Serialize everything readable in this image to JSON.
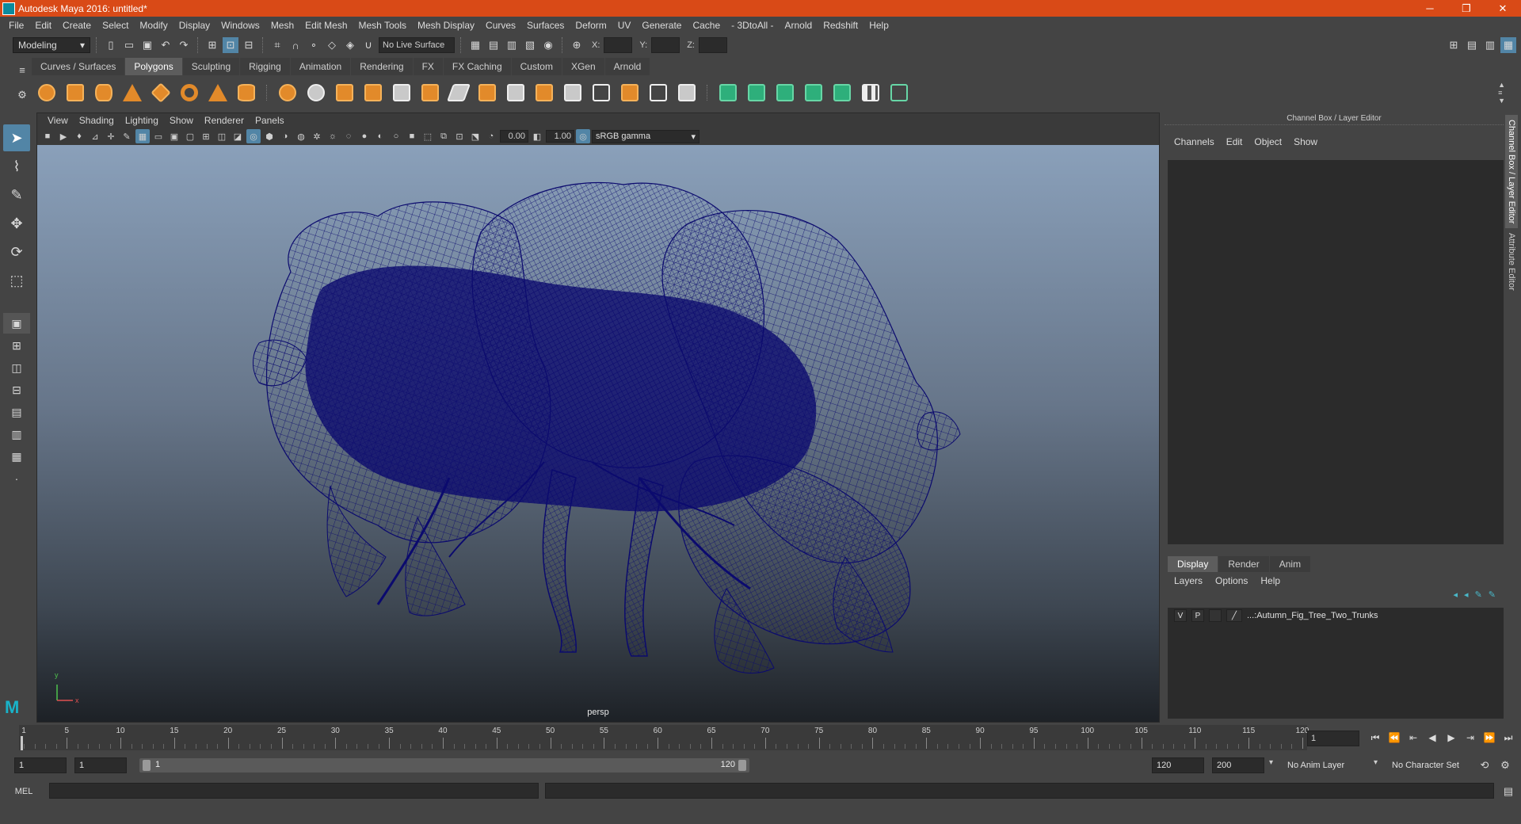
{
  "title_bar": {
    "title": "Autodesk Maya 2016: untitled*",
    "minimize": "─",
    "restore": "❐",
    "close": "✕"
  },
  "menu": [
    "File",
    "Edit",
    "Create",
    "Select",
    "Modify",
    "Display",
    "Windows",
    "Mesh",
    "Edit Mesh",
    "Mesh Tools",
    "Mesh Display",
    "Curves",
    "Surfaces",
    "Deform",
    "UV",
    "Generate",
    "Cache",
    "- 3DtoAll -",
    "Arnold",
    "Redshift",
    "Help"
  ],
  "status_line": {
    "mode": "Modeling",
    "live_surface": "No Live Surface",
    "x_label": "X:",
    "y_label": "Y:",
    "z_label": "Z:"
  },
  "shelf": {
    "tabs": [
      "Curves / Surfaces",
      "Polygons",
      "Sculpting",
      "Rigging",
      "Animation",
      "Rendering",
      "FX",
      "FX Caching",
      "Custom",
      "XGen",
      "Arnold"
    ],
    "active_tab": "Polygons"
  },
  "viewport": {
    "menu": [
      "View",
      "Shading",
      "Lighting",
      "Show",
      "Renderer",
      "Panels"
    ],
    "exposure": "0.00",
    "gamma": "1.00",
    "color_space": "sRGB gamma",
    "camera": "persp",
    "axis_y": "y",
    "axis_x": "x"
  },
  "channel_box": {
    "title": "Channel Box / Layer Editor",
    "menu": [
      "Channels",
      "Edit",
      "Object",
      "Show"
    ]
  },
  "layer_editor": {
    "tabs": [
      "Display",
      "Render",
      "Anim"
    ],
    "active_tab": "Display",
    "menu": [
      "Layers",
      "Options",
      "Help"
    ],
    "layers": [
      {
        "v": "V",
        "p": "P",
        "name": "...:Autumn_Fig_Tree_Two_Trunks"
      }
    ]
  },
  "side_tabs": [
    "Channel Box / Layer Editor",
    "Attribute Editor"
  ],
  "time_slider": {
    "ticks": [
      5,
      10,
      15,
      20,
      25,
      30,
      35,
      40,
      45,
      50,
      55,
      60,
      65,
      70,
      75,
      80,
      85,
      90,
      95,
      100,
      105,
      110,
      115,
      120
    ],
    "start_label": "1",
    "current_frame": "1"
  },
  "range": {
    "start": "1",
    "playback_start": "1",
    "range_start_label": "1",
    "range_end_label": "120",
    "playback_end": "120",
    "end": "200",
    "anim_layer": "No Anim Layer",
    "character_set": "No Character Set"
  },
  "command_line": {
    "label": "MEL"
  },
  "colors": {
    "title_bar": "#d94a17",
    "wireframe": "#0b0a6e",
    "accent": "#5285a6"
  }
}
